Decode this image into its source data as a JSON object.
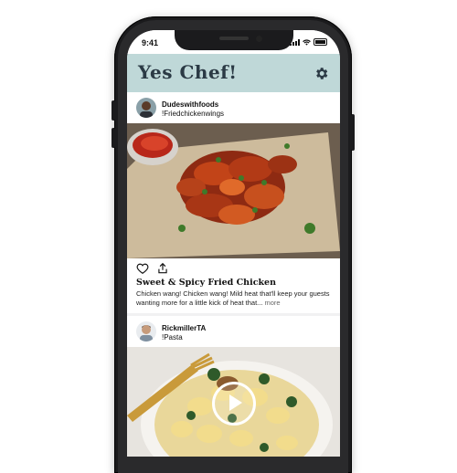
{
  "status_bar": {
    "time": "9:41"
  },
  "header": {
    "app_title": "Yes Chef!",
    "settings_icon": "gear-icon",
    "background": "#bfd8d8"
  },
  "posts": [
    {
      "username": "Dudeswithfoods",
      "tag": "!Friedchickenwings",
      "title": "Sweet & Spicy Fried Chicken",
      "description": "Chicken wang! Chicken wang! Mild heat that'll keep your guests wanting more for a little kick of heat that...",
      "more_label": "more",
      "like_icon": "heart-icon",
      "share_icon": "share-icon"
    },
    {
      "username": "RickmillerTA",
      "tag": "!Pasta",
      "media_icon": "play-icon"
    }
  ]
}
